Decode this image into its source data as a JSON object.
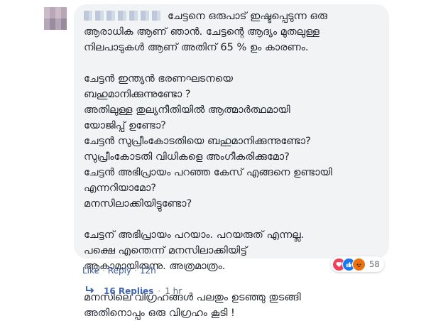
{
  "comment": {
    "lines": [
      "ചേട്ടനെ ഒരുപാട് ഇഷ്ടപ്പെടുന്ന ഒരു",
      "ആരാധിക ആണ് ഞാൻ. ചേട്ടന്റെ ആദ്യം മുതലുള്ള",
      "നിലപാടുകൾ ആണ് അതിന് 65 % ഉം കാരണം.",
      "",
      "ചേട്ടൻ ഇന്ത്യൻ ഭരണഘടനയെ",
      "ബഹുമാനിക്കുന്നുണ്ടോ ?",
      "അതിലുള്ള തുല്യനീതിയിൽ ആത്മാർത്ഥമായി",
      "യോജിപ്പ് ഉണ്ടോ?",
      "ചേട്ടൻ സുപ്രീംകോടതിയെ ബഹുമാനിക്കുന്നുണ്ടോ?",
      "സുപ്രീംകോടതി വിധികളെ അംഗീകരിക്കുമോ?",
      "ചേട്ടൻ അഭിപ്രായം പറഞ്ഞ കേസ് എങ്ങനെ ഉണ്ടായി",
      "എന്നറിയാമോ?",
      "മനസിലാക്കിയിട്ടുണ്ടോ?",
      "",
      "ചേട്ടന് അഭിപ്രായം പറയാം. പറയരുത് എന്നല്ല.",
      "പക്ഷെ എന്തെന്ന് മനസിലാക്കിയിട്ട്",
      "ആകാമായിരുന്നു. അത്രമാത്രം.",
      "",
      "മനസിലെ വിഗ്രഹങ്ങൾ പലതും ഉടഞ്ഞു തുടങ്ങി",
      "അതിനൊപ്പം ഒരു വിഗ്രഹം കൂടി !"
    ]
  },
  "reactions": {
    "icons": [
      "heart-icon",
      "thumbs-up-icon",
      "angry-icon"
    ],
    "count": "58",
    "colors": {
      "love": "#f33e58",
      "like": "#1877f2",
      "angry": "#e9710f"
    }
  },
  "actions": {
    "like": "Like",
    "reply": "Reply",
    "separator": "·",
    "time": "12h"
  },
  "replies": {
    "label": "16 Replies",
    "separator": "·",
    "time": "1 hr"
  }
}
